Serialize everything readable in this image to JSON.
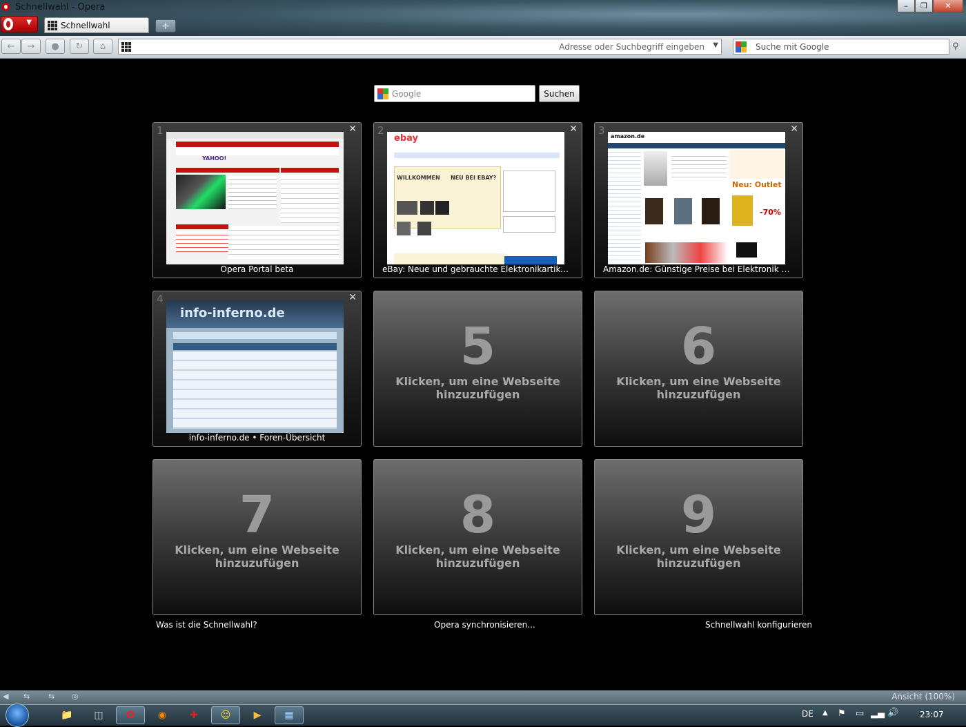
{
  "window": {
    "title": "Schnellwahl - Opera"
  },
  "tab": {
    "label": "Schnellwahl"
  },
  "address": {
    "placeholder": "Adresse oder Suchbegriff eingeben"
  },
  "search": {
    "placeholder": "Suche mit Google"
  },
  "speeddial": {
    "search_placeholder": "Google",
    "search_button": "Suchen",
    "dials": [
      {
        "num": "1",
        "caption": "Opera Portal beta",
        "icon": "thumbnail"
      },
      {
        "num": "2",
        "caption": "eBay: Neue und gebrauchte Elektronikartikel, ...",
        "icon": "thumbnail"
      },
      {
        "num": "3",
        "caption": "Amazon.de: Günstige Preise bei Elektronik & F...",
        "icon": "thumbnail"
      },
      {
        "num": "4",
        "caption": "info-inferno.de • Foren-Übersicht",
        "icon": "thumbnail"
      },
      {
        "num": "5",
        "hint_line1": "Klicken, um eine Webseite",
        "hint_line2": "hinzuzufügen"
      },
      {
        "num": "6",
        "hint_line1": "Klicken, um eine Webseite",
        "hint_line2": "hinzuzufügen"
      },
      {
        "num": "7",
        "hint_line1": "Klicken, um eine Webseite",
        "hint_line2": "hinzuzufügen"
      },
      {
        "num": "8",
        "hint_line1": "Klicken, um eine Webseite",
        "hint_line2": "hinzuzufügen"
      },
      {
        "num": "9",
        "hint_line1": "Klicken, um eine Webseite",
        "hint_line2": "hinzuzufügen"
      }
    ],
    "thumb_text": {
      "site1_logo": "YAHOO!",
      "site2_logo": "ebay",
      "site2_welcome": "WILLKOMMEN",
      "site2_neu": "NEU BEI EBAY?",
      "site3_logo": "amazon.de",
      "site3_outlet": "Neu: Outlet",
      "site3_percent": "-70%",
      "site4_logo": "info-inferno.de"
    },
    "footer": {
      "help": "Was ist die Schnellwahl?",
      "sync": "Opera synchronisieren...",
      "configure": "Schnellwahl konfigurieren"
    }
  },
  "statusbar": {
    "zoom": "Ansicht (100%)"
  },
  "taskbar": {
    "lang": "DE",
    "clock": "23:07"
  },
  "colors": {
    "accent": "#cc0000",
    "background": "#000000"
  }
}
